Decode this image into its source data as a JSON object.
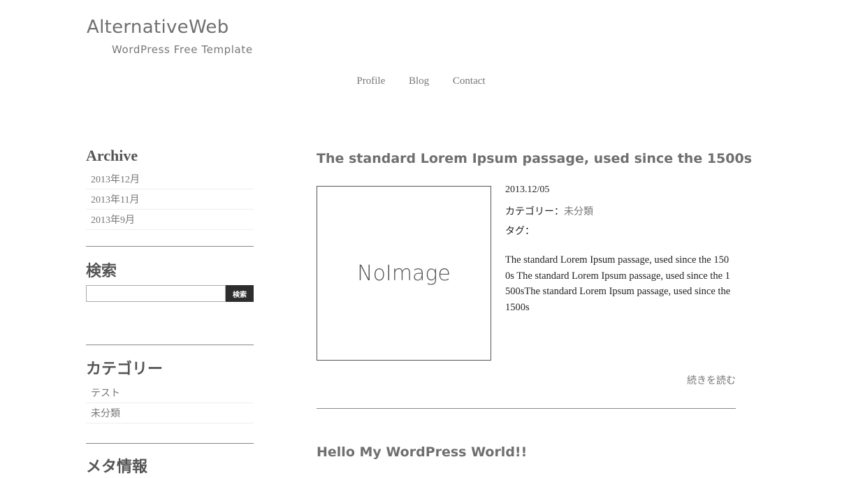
{
  "header": {
    "title": "AlternativeWeb",
    "description": "WordPress Free Template"
  },
  "nav": {
    "items": [
      "Profile",
      "Blog",
      "Contact"
    ]
  },
  "sidebar": {
    "archive": {
      "title": "Archive",
      "items": [
        "2013年12月",
        "2013年11月",
        "2013年9月"
      ]
    },
    "search": {
      "title": "検索",
      "button_label": "検索",
      "input_value": ""
    },
    "category": {
      "title": "カテゴリー",
      "items": [
        "テスト",
        "未分類"
      ]
    },
    "meta": {
      "title": "メタ情報"
    }
  },
  "posts": [
    {
      "title": "The standard Lorem Ipsum passage, used since the 1500s",
      "thumbnail_text": "NoImage",
      "date": "2013.12/05",
      "category_label": "カテゴリー：",
      "category_value": "未分類",
      "tag_label": "タグ：",
      "excerpt": "The standard Lorem Ipsum passage, used since the 1500s The standard Lorem Ipsum passage, used since the 1500sThe standard Lorem Ipsum passage, used since the 1500s",
      "more_label": "続きを読む"
    },
    {
      "title": "Hello My WordPress World!!"
    }
  ]
}
